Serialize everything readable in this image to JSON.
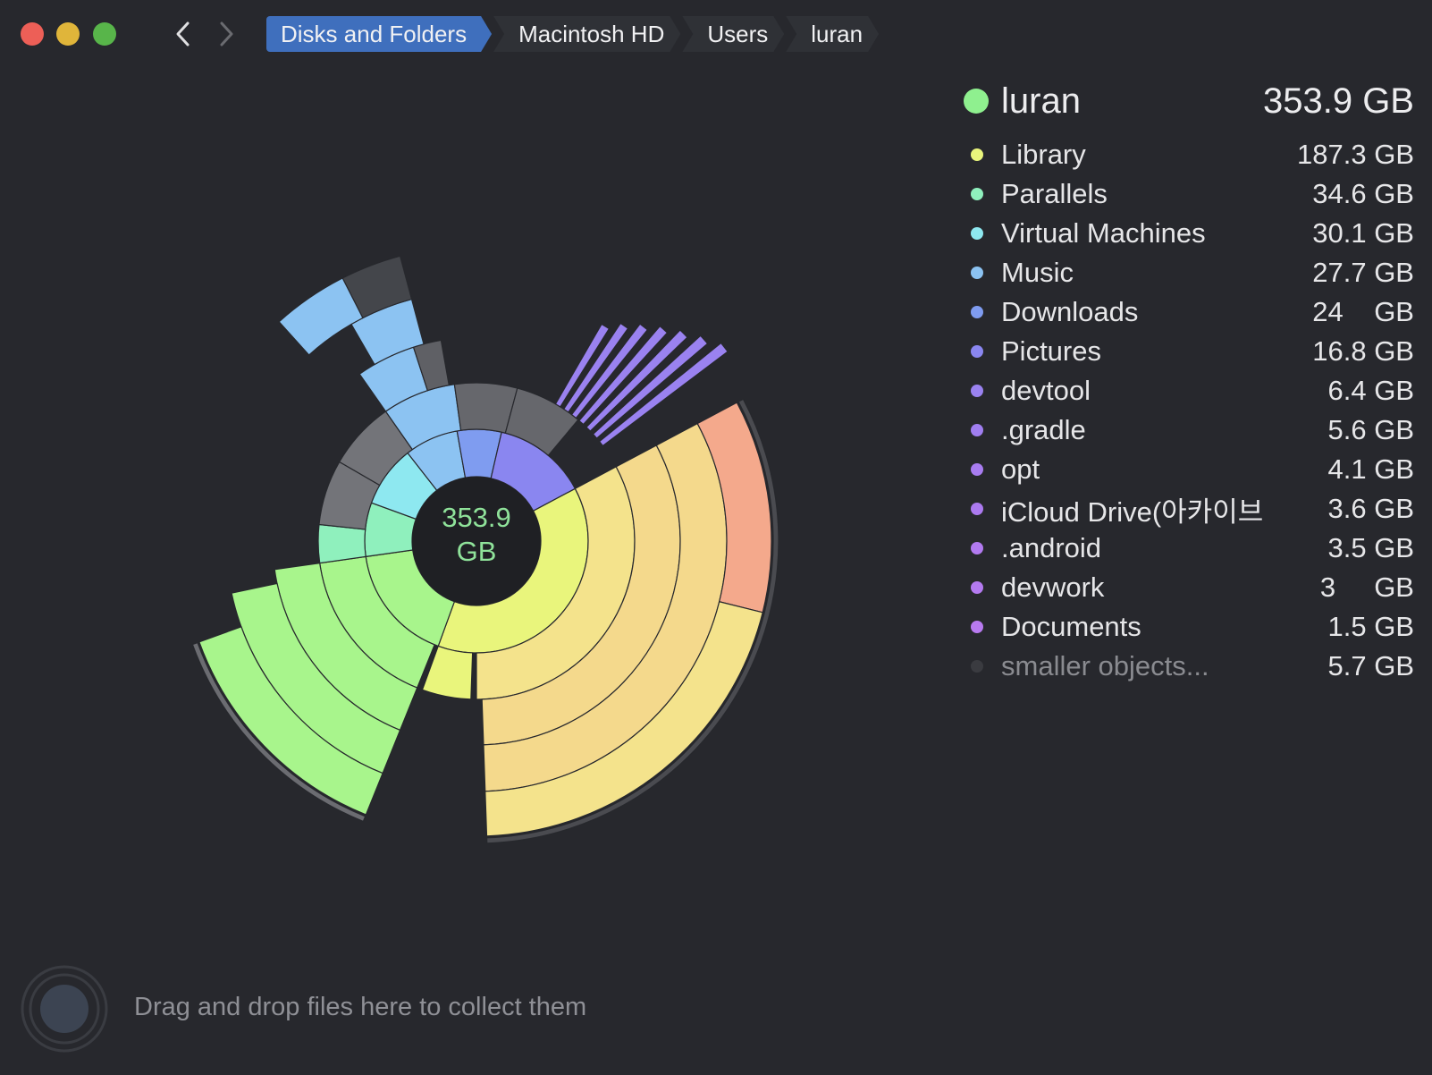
{
  "window": {
    "breadcrumb": [
      "Disks and Folders",
      "Macintosh HD",
      "Users",
      "luran"
    ]
  },
  "sunburst": {
    "center_value": "353.9",
    "center_unit": "GB"
  },
  "legend": {
    "root": {
      "name": "luran",
      "size": "353.9 GB",
      "color": "#8ff08f"
    },
    "items": [
      {
        "name": "Library",
        "size": "187.3 GB",
        "color": "#e9f57c"
      },
      {
        "name": "Parallels",
        "size": "34.6 GB",
        "color": "#8ff0bd"
      },
      {
        "name": "Virtual Machines",
        "size": "30.1 GB",
        "color": "#8ee8f0"
      },
      {
        "name": "Music",
        "size": "27.7 GB",
        "color": "#8cc3f2"
      },
      {
        "name": "Downloads",
        "size": "24    GB",
        "color": "#7f9cf0"
      },
      {
        "name": "Pictures",
        "size": "16.8 GB",
        "color": "#8a86f0"
      },
      {
        "name": "devtool",
        "size": "6.4 GB",
        "color": "#9a82f0"
      },
      {
        "name": ".gradle",
        "size": "5.6 GB",
        "color": "#a07ef0"
      },
      {
        "name": "opt",
        "size": "4.1 GB",
        "color": "#a87cf0"
      },
      {
        "name": "iCloud Drive(아카이브",
        "size": "3.6 GB",
        "color": "#ac7af0"
      },
      {
        "name": ".android",
        "size": "3.5 GB",
        "color": "#b27af0"
      },
      {
        "name": "devwork",
        "size": "3     GB",
        "color": "#b47af0"
      },
      {
        "name": "Documents",
        "size": "1.5 GB",
        "color": "#b87af0"
      },
      {
        "name": "smaller objects...",
        "size": "5.7 GB",
        "color": "#3a3b40"
      }
    ]
  },
  "dropzone": {
    "text": "Drag and drop files here to collect them"
  }
}
